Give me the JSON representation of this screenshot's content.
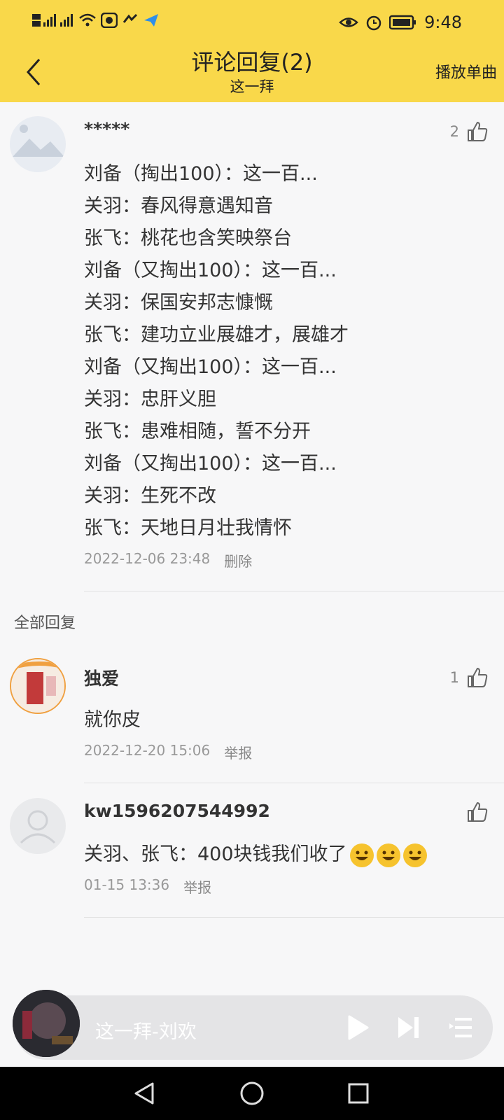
{
  "status_bar": {
    "time": "9:48"
  },
  "header": {
    "title": "评论回复(2)",
    "subtitle": "这一拜",
    "play_single": "播放单曲"
  },
  "main_comment": {
    "username": "*****",
    "like_count": "2",
    "lines": [
      "刘备（掏出100）：这一百...",
      "关羽：春风得意遇知音",
      "张飞：桃花也含笑映祭台",
      "刘备（又掏出100）：这一百...",
      "关羽：保国安邦志慷慨",
      "张飞：建功立业展雄才，展雄才",
      "刘备（又掏出100）：这一百...",
      "关羽：忠肝义胆",
      "张飞：患难相随，誓不分开",
      "刘备（又掏出100）：这一百...",
      "关羽：生死不改",
      "张飞：天地日月壮我情怀"
    ],
    "time": "2022-12-06 23:48",
    "action": "删除"
  },
  "section_label": "全部回复",
  "replies": [
    {
      "username": "独爱",
      "like_count": "1",
      "text": "就你皮",
      "time": "2022-12-20 15:06",
      "action": "举报"
    },
    {
      "username": "kw1596207544992",
      "like_count": "",
      "text": "关羽、张飞：400块钱我们收了",
      "time": "01-15 13:36",
      "action": "举报"
    }
  ],
  "player": {
    "title": "这一拜-刘欢"
  },
  "colors": {
    "header_bg": "#f9d84a",
    "page_bg": "#f7f7f8"
  }
}
